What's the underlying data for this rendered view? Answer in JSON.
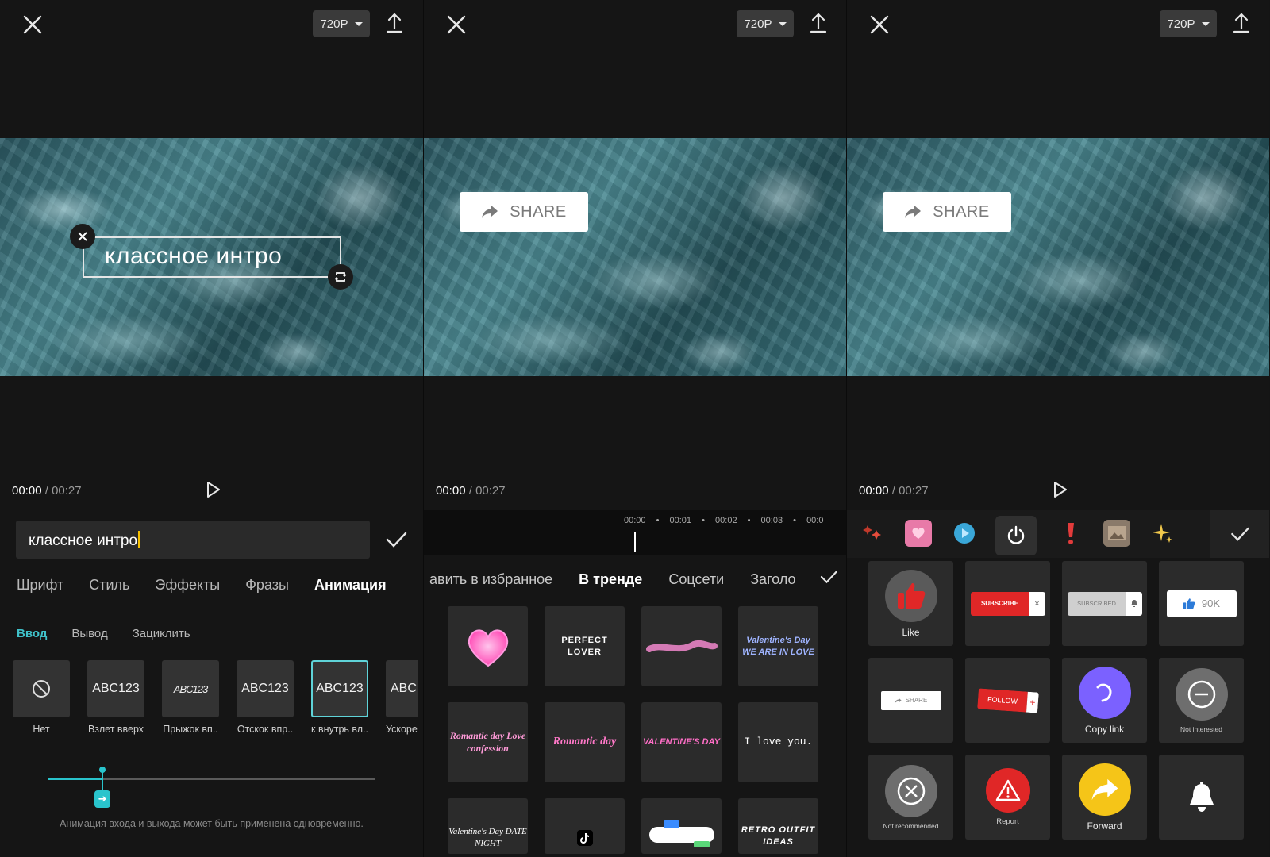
{
  "common": {
    "resolution": "720P",
    "time_current": "00:00",
    "time_separator": "/",
    "time_total": "00:27"
  },
  "panel1": {
    "overlay_text": "классное  интро",
    "input_value": "классное интро",
    "tabs": [
      "Шрифт",
      "Стиль",
      "Эффекты",
      "Фразы",
      "Анимация"
    ],
    "active_tab": "Анимация",
    "subtabs": [
      "Ввод",
      "Вывод",
      "Зациклить"
    ],
    "active_subtab": "Ввод",
    "animations": [
      {
        "thumb": "",
        "label": "Нет"
      },
      {
        "thumb": "ABC123",
        "label": "Взлет вверх"
      },
      {
        "thumb": "ABC123",
        "label": "Прыжок вп.."
      },
      {
        "thumb": "ABC123",
        "label": "Отскок впр.."
      },
      {
        "thumb": "ABC123",
        "label": "к внутрь вл.."
      },
      {
        "thumb": "ABC",
        "label": "Ускоре"
      }
    ],
    "hint": "Анимация входа и выхода может быть применена одновременно."
  },
  "panel2": {
    "sticker_label": "SHARE",
    "timeline_ticks": [
      "00:00",
      "•",
      "00:01",
      "•",
      "00:02",
      "•",
      "00:03",
      "•",
      "00:0"
    ],
    "tabs": [
      "авить в избранное",
      "В тренде",
      "Соцсети",
      "Заголо"
    ],
    "active_tab": "В тренде",
    "tiles": [
      {
        "text": "",
        "color": "#ff6ec7"
      },
      {
        "text": "PERFECT LOVER",
        "color": "#ffffff"
      },
      {
        "text": "",
        "color": "#ff8fd8"
      },
      {
        "text": "Valentine's Day WE ARE IN LOVE",
        "color": "#9fb4ff"
      },
      {
        "text": "Romantic day Love confession",
        "color": "#ff9ad8"
      },
      {
        "text": "Romantic day",
        "color": "#ff78c8"
      },
      {
        "text": "VALENTINE'S DAY",
        "color": "#ff6ec7"
      },
      {
        "text": "I love you.",
        "color": "#f0f0f0"
      },
      {
        "text": "Valentine's Day DATE NIGHT",
        "color": "#dddddd"
      },
      {
        "text": "",
        "color": "#ffffff"
      },
      {
        "text": "",
        "color": "#5bd87a"
      },
      {
        "text": "RETRO OUTFIT IDEAS",
        "color": "#ffffff"
      }
    ]
  },
  "panel3": {
    "sticker_label": "SHARE",
    "stickers": [
      {
        "type": "like",
        "label": "Like"
      },
      {
        "type": "subscribe",
        "label": "SUBSCRIBE"
      },
      {
        "type": "subscribed",
        "label": "SUBSCRIBED"
      },
      {
        "type": "count",
        "label": "90K"
      },
      {
        "type": "share",
        "label": "SHARE"
      },
      {
        "type": "follow",
        "label": "FOLLOW"
      },
      {
        "type": "copylink",
        "label": "Copy link"
      },
      {
        "type": "notinterested",
        "label": "Not interested"
      },
      {
        "type": "notrecommended",
        "label": "Not recommended"
      },
      {
        "type": "report",
        "label": "Report"
      },
      {
        "type": "forward",
        "label": "Forward"
      },
      {
        "type": "bell",
        "label": ""
      }
    ]
  }
}
